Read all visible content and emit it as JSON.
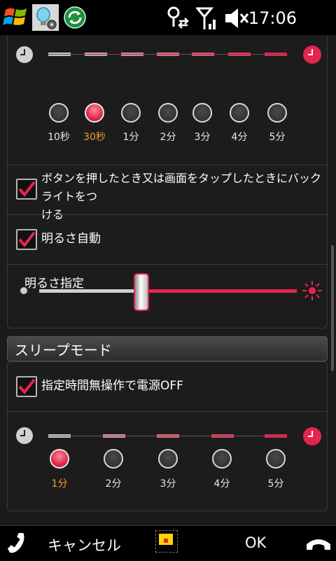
{
  "status_bar": {
    "start_icon": "windows-start-icon",
    "icons": [
      "lightbulb-gear-icon",
      "sync-icon",
      "connectivity-icon",
      "signal-icon",
      "volume-muted-icon"
    ],
    "time": "17:06"
  },
  "backlight": {
    "timeout_options": [
      "10秒",
      "30秒",
      "1分",
      "2分",
      "3分",
      "4分",
      "5分"
    ],
    "selected_index": 1,
    "touch_checkbox_label": "ボタンを押したとき又は画面をタップしたときにバックライトをつ",
    "touch_checkbox_label_line2": "ける",
    "touch_checked": true,
    "auto_brightness_label": "明るさ自動",
    "auto_brightness_checked": true,
    "brightness_label": "明るさ指定",
    "brightness_level": 0.5
  },
  "sleep_mode": {
    "heading": "スリープモード",
    "auto_off_label": "指定時間無操作で電源OFF",
    "auto_off_checked": true,
    "timeout_options": [
      "1分",
      "2分",
      "3分",
      "4分",
      "5分"
    ],
    "selected_index": 0
  },
  "bottom_bar": {
    "cancel_label": "キャンセル",
    "ok_label": "OK"
  },
  "colors": {
    "accent": "#e0284a",
    "selected_text": "#f0a030",
    "background": "#1b1b1b"
  }
}
